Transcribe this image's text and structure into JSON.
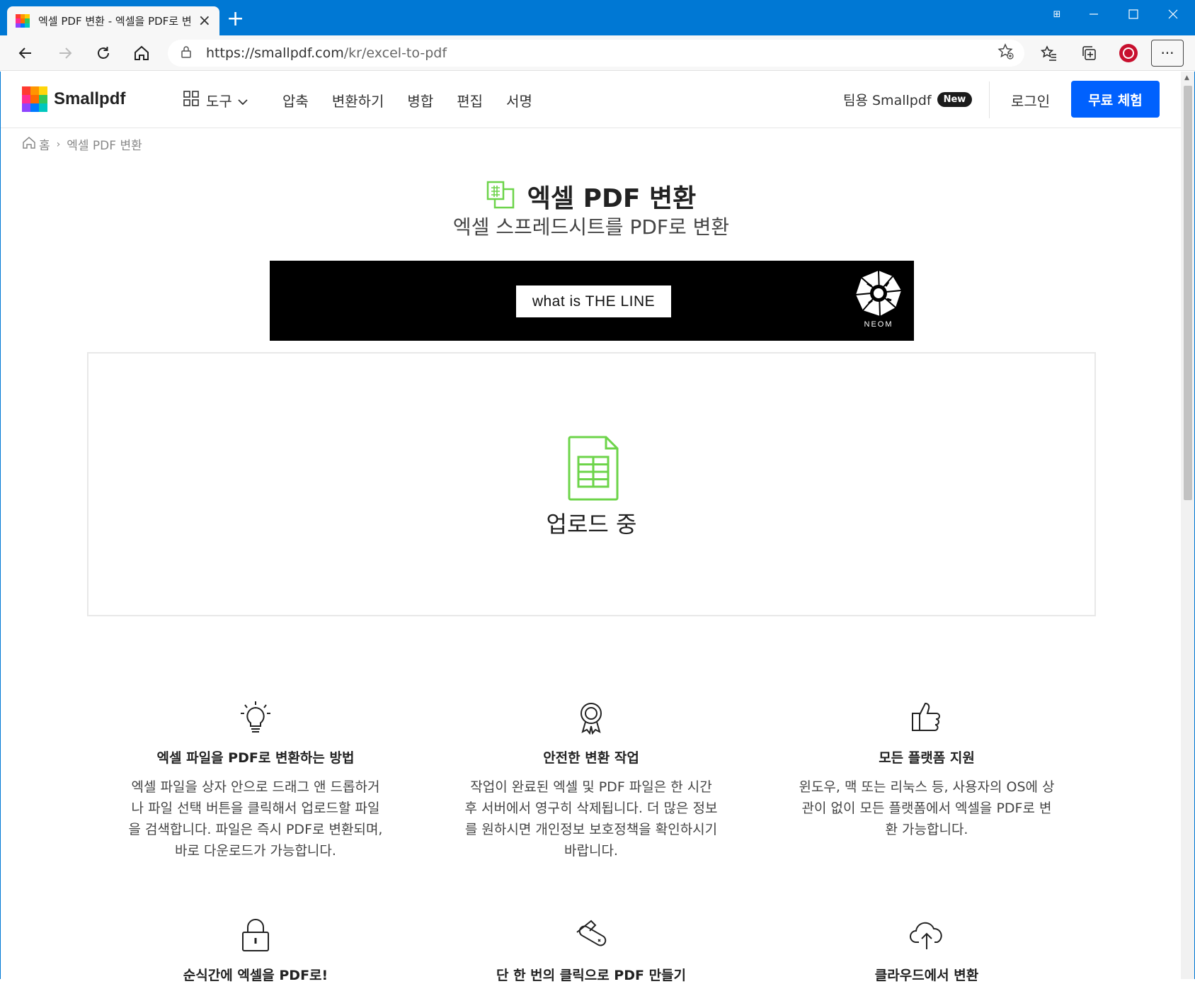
{
  "browser": {
    "tab_title": "엑셀 PDF 변환 - 엑셀을 PDF로 변",
    "url_host": "https://smallpdf.com",
    "url_path": "/kr/excel-to-pdf"
  },
  "header": {
    "logo_text": "Smallpdf",
    "tools_label": "도구",
    "nav": [
      "압축",
      "변환하기",
      "병합",
      "편집",
      "서명"
    ],
    "team_label": "팀용 Smallpdf",
    "new_badge": "New",
    "login_label": "로그인",
    "trial_label": "무료 체험",
    "brand_color": "#0061fe"
  },
  "breadcrumb": {
    "home": "홈",
    "current": "엑셀 PDF 변환"
  },
  "hero": {
    "title": "엑셀 PDF 변환",
    "subtitle": "엑셀 스프레드시트를 PDF로 변환"
  },
  "ad": {
    "button_text": "what is THE LINE",
    "brand": "NEOM"
  },
  "dropzone": {
    "status": "업로드 중"
  },
  "features": [
    {
      "icon": "lightbulb-icon",
      "title": "엑셀 파일을 PDF로 변환하는 방법",
      "text": "엑셀 파일을 상자 안으로 드래그 앤 드롭하거나 파일 선택 버튼을 클릭해서 업로드할 파일을 검색합니다. 파일은 즉시 PDF로 변환되며, 바로 다운로드가 가능합니다."
    },
    {
      "icon": "award-icon",
      "title": "안전한 변환 작업",
      "text": "작업이 완료된 엑셀 및 PDF 파일은 한 시간 후 서버에서 영구히 삭제됩니다. 더 많은 정보를 원하시면 개인정보 보호정책을 확인하시기 바랍니다."
    },
    {
      "icon": "thumbs-up-icon",
      "title": "모든 플랫폼 지원",
      "text": "윈도우, 맥 또는 리눅스 등, 사용자의 OS에 상관이 없이 모든 플랫폼에서 엑셀을 PDF로 변환 가능합니다."
    },
    {
      "icon": "lock-icon",
      "title": "순식간에 엑셀을 PDF로!",
      "text": ""
    },
    {
      "icon": "swiss-knife-icon",
      "title": "단 한 번의 클릭으로 PDF 만들기",
      "text": ""
    },
    {
      "icon": "cloud-upload-icon",
      "title": "클라우드에서 변환",
      "text": ""
    }
  ]
}
